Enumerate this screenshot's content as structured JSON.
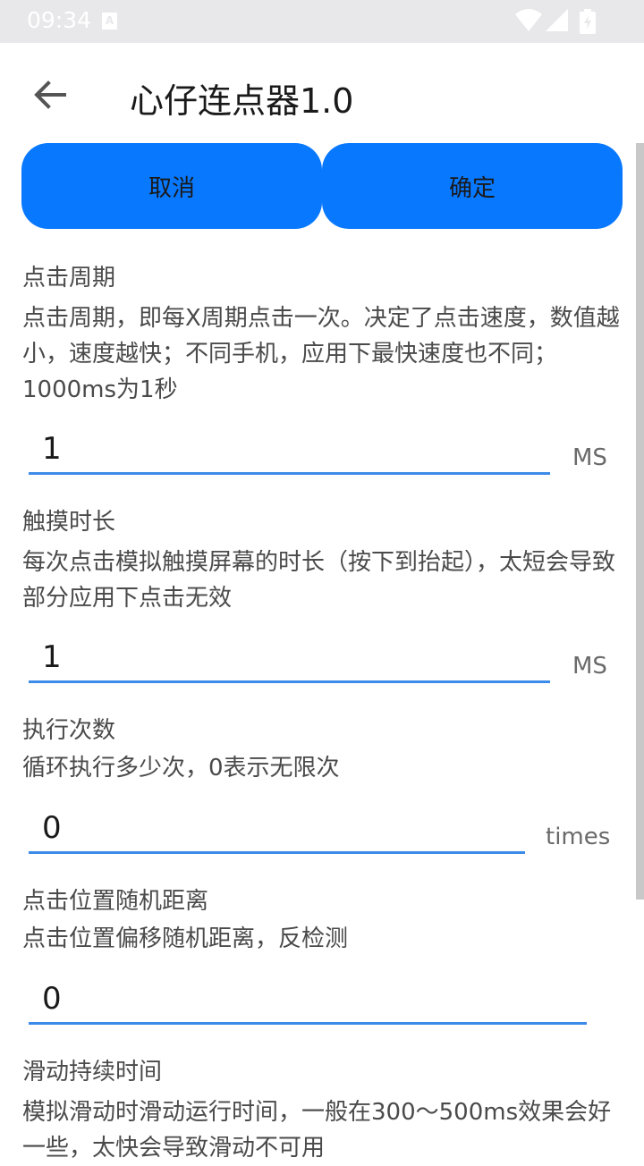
{
  "status_bar": {
    "time": "09:34",
    "notification_icon": "A",
    "icons": [
      "wifi-icon",
      "signal-icon",
      "battery-icon"
    ]
  },
  "app_bar": {
    "title": "心仔连点器1.0",
    "back_icon": "arrow-left-icon"
  },
  "actions": {
    "cancel_label": "取消",
    "confirm_label": "确定"
  },
  "sections": {
    "click_period": {
      "title": "点击周期",
      "description": "点击周期，即每X周期点击一次。决定了点击速度，数值越小，速度越快；不同手机，应用下最快速度也不同；1000ms为1秒",
      "value": "1",
      "unit": "MS"
    },
    "touch_duration": {
      "title": "触摸时长",
      "description": "每次点击模拟触摸屏幕的时长（按下到抬起），太短会导致部分应用下点击无效",
      "value": "1",
      "unit": "MS"
    },
    "exec_count": {
      "title": "执行次数",
      "description": "循环执行多少次，0表示无限次",
      "value": "0",
      "unit": "times"
    },
    "random_distance": {
      "title": "点击位置随机距离",
      "description": "点击位置偏移随机距离，反检测",
      "value": "0"
    },
    "swipe_duration": {
      "title": "滑动持续时间",
      "description": "模拟滑动时滑动运行时间，一般在300～500ms效果会好一些，太快会导致滑动不可用"
    }
  },
  "colors": {
    "accent": "#0878ff",
    "underline": "#3d8be8",
    "status_bar": "#e8e8ea"
  }
}
